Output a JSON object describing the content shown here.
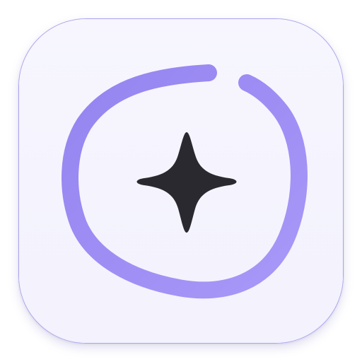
{
  "app_icon": {
    "icon": "sparkle-in-circle-icon",
    "colors": {
      "background": "#f6f5fe",
      "border": "#a9a3ef",
      "ring": "#9b8cf3",
      "ring_light": "#a392f7",
      "star": "#2a2930"
    }
  }
}
